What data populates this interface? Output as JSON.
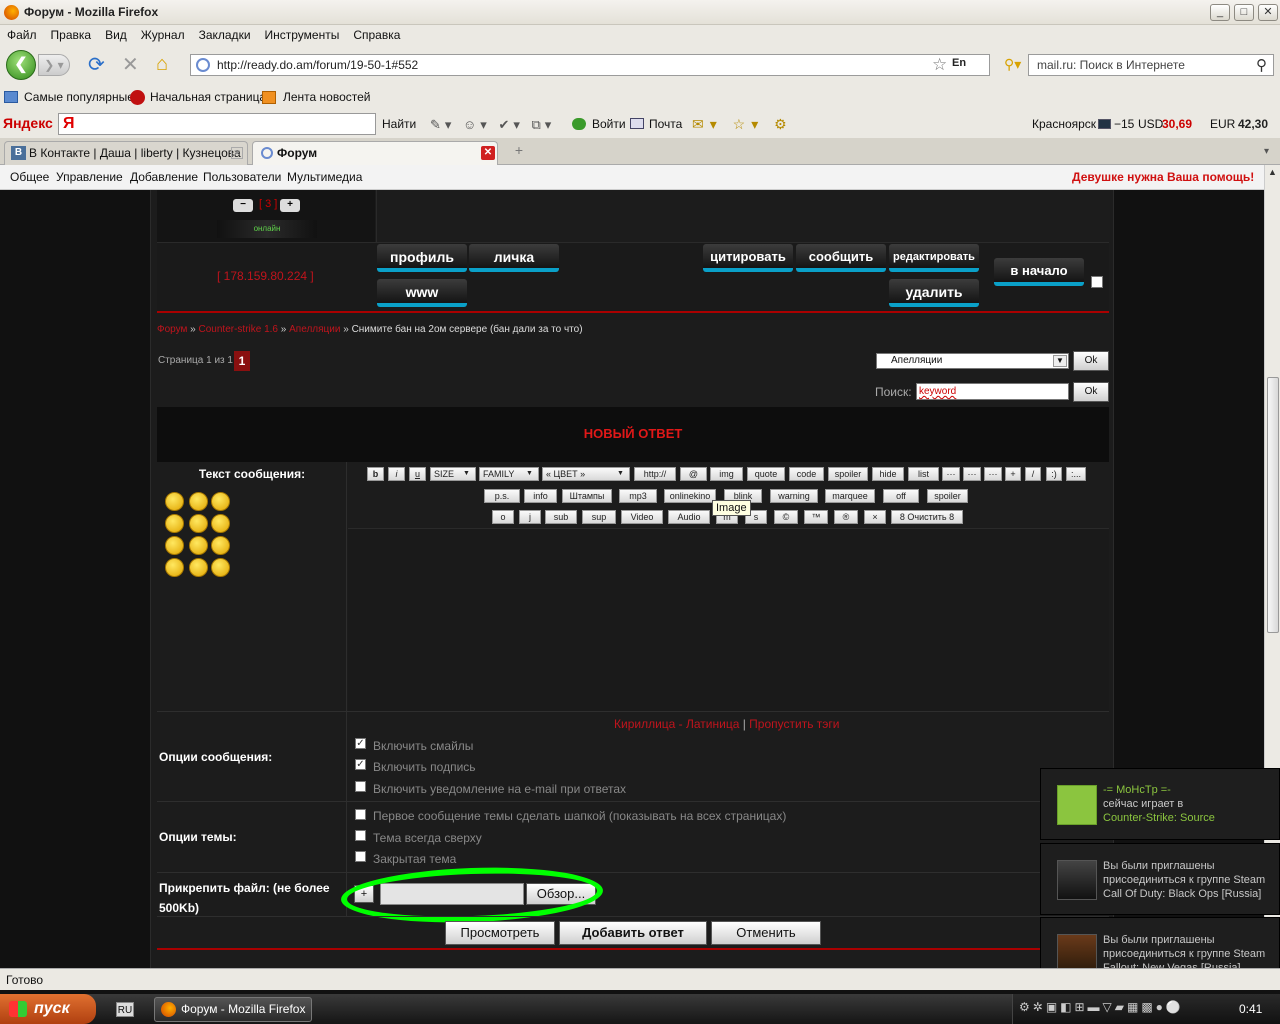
{
  "window": {
    "title": "Форум - Mozilla Firefox"
  },
  "menu": [
    "Файл",
    "Правка",
    "Вид",
    "Журнал",
    "Закладки",
    "Инструменты",
    "Справка"
  ],
  "nav": {
    "url": "http://ready.do.am/forum/19-50-1#552",
    "lang": "En",
    "search_placeholder": "mail.ru: Поиск в Интернете"
  },
  "bookmarks": [
    "Самые популярные",
    "Начальная страница",
    "Лента новостей"
  ],
  "yandex": {
    "logo": "Яндекс",
    "find": "Найти",
    "login": "Войти",
    "mail": "Почта",
    "city": "Красноярск",
    "temp": "−15",
    "usd_label": "USD",
    "usd": "30,69",
    "eur_label": "EUR",
    "eur": "42,30"
  },
  "tabs": [
    {
      "label": "В Контакте | Даша | liberty | Кузнецова"
    },
    {
      "label": "Форум"
    }
  ],
  "sitenav": {
    "items": [
      "Общее",
      "Управление",
      "Добавление",
      "Пользователи",
      "Мультимедиа"
    ],
    "alert": "Девушке нужна Ваша помощь!"
  },
  "post": {
    "rep": "3",
    "online": "онлайн",
    "ip": "[ 178.159.80.224 ]",
    "buttons": {
      "profile": "профиль",
      "pm": "личка",
      "www": "www",
      "quote": "цитировать",
      "report": "сообщить",
      "edit": "редактировать",
      "delete": "удалить",
      "top": "в начало"
    }
  },
  "breadcrumb": {
    "forum": "Форум",
    "cat": "Counter-strike 1.6",
    "sub": "Апелляции",
    "sep": "»",
    "topic": "Снимите бан на 2ом сервере (бан дали за то что)"
  },
  "pages": {
    "label": "Страница 1 из 1",
    "current": "1"
  },
  "jump": {
    "selected": "Апелляции",
    "ok": "Ok"
  },
  "search": {
    "label": "Поиск:",
    "value": "keyword",
    "ok": "Ok"
  },
  "reply": {
    "title": "НОВЫЙ ОТВЕТ",
    "text_label": "Текст сообщения:"
  },
  "toolbar": {
    "row1": [
      "b",
      "i",
      "u",
      "SIZE",
      "FAMILY",
      "« ЦВЕТ »",
      "http://",
      "@",
      "img",
      "quote",
      "code",
      "spoiler",
      "hide",
      "list",
      "···",
      "···",
      "···",
      "+",
      "/",
      ":)",
      ":..."
    ],
    "row2": [
      "p.s.",
      "info",
      "Штампы",
      "mp3",
      "onlinekino",
      "blink",
      "warning",
      "marquee",
      "off",
      "spoiler"
    ],
    "row3": [
      "o",
      "j",
      "sub",
      "sup",
      "Video",
      "Audio",
      "m",
      "s",
      "©",
      "™",
      "®",
      "×",
      "8 Очистить 8"
    ],
    "tooltip": "Image"
  },
  "translit": {
    "cyr": "Кириллица",
    "sep1": " - ",
    "lat": "Латиница",
    "sep2": " | ",
    "skip": "Пропустить тэги"
  },
  "options": {
    "msg_label": "Опции сообщения:",
    "msg": [
      {
        "label": "Включить смайлы",
        "checked": true
      },
      {
        "label": "Включить подпись",
        "checked": true
      },
      {
        "label": "Включить уведомление на e-mail при ответах",
        "checked": false
      }
    ],
    "topic_label": "Опции темы:",
    "topic": [
      {
        "label": "Первое сообщение темы сделать шапкой (показывать на всех страницах)",
        "checked": false
      },
      {
        "label": "Тема всегда сверху",
        "checked": false
      },
      {
        "label": "Закрытая тема",
        "checked": false
      }
    ],
    "attach_label": "Прикрепить файл: (не более 500Kb)",
    "plus": "+",
    "browse": "Обзор..."
  },
  "actions": {
    "preview": "Просмотреть",
    "submit": "Добавить ответ",
    "cancel": "Отменить"
  },
  "status": "Готово",
  "taskbar": {
    "start": "пуск",
    "lang": "RU",
    "window": "Форум - Mozilla Firefox",
    "clock": "0:41"
  },
  "steam": [
    {
      "name": "-= MoHcTp =-",
      "line": "сейчас играет в",
      "game": "Counter-Strike: Source"
    },
    {
      "l1": "Вы были приглашены",
      "l2": "присоединиться к группе Steam",
      "l3": "Call Of Duty: Black Ops [Russia]"
    },
    {
      "l1": "Вы были приглашены",
      "l2": "присоединиться к группе Steam",
      "l3": "Fallout: New Vegas [Russia]"
    }
  ],
  "colors": {
    "accent_red": "#d01010",
    "link_red": "#c0141c",
    "green_ring": "#00ff00",
    "steam_green": "#8bc53f"
  }
}
